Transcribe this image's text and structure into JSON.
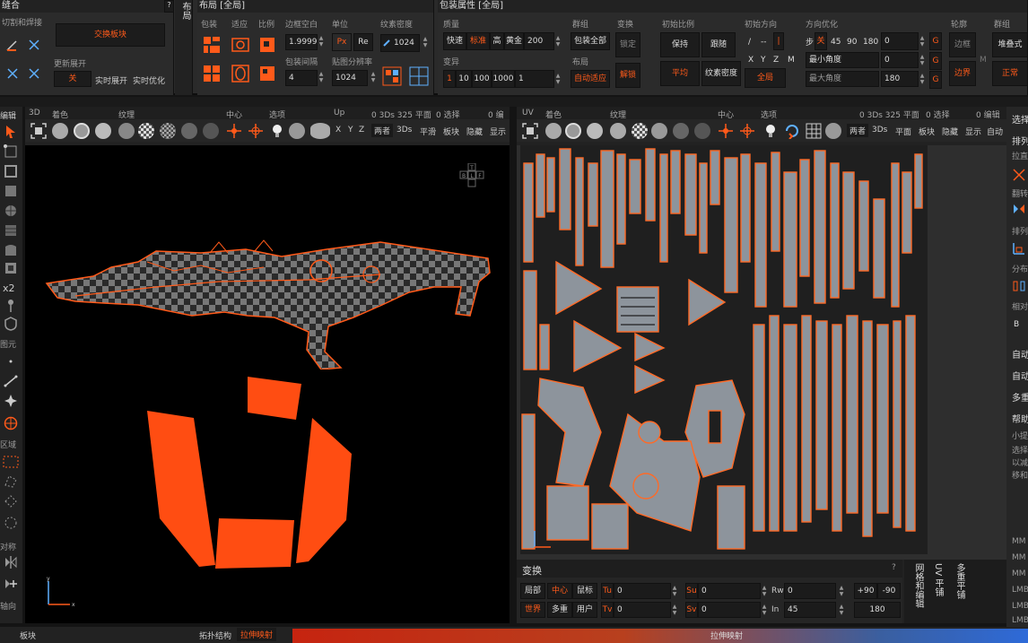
{
  "stitch_panel": {
    "title": "缝合",
    "cut_label": "切割和焊接",
    "swap_btn": "交换板块",
    "new_unfold": "更新展开",
    "off": "关",
    "realtime_unfold": "实时展开",
    "realtime_opt": "实时优化"
  },
  "side_tab": "布局",
  "layout_panel": {
    "title": "布局 [全局]",
    "pack": "包装",
    "adapt": "适应",
    "ratio": "比例",
    "margin": "边框空白",
    "unit": "单位",
    "texel": "纹素密度",
    "margin_val": "1.9999",
    "px": "Px",
    "re": "Re",
    "texel_val": "1024",
    "spacing": "包装间隔",
    "resolution": "贴图分辨率",
    "spacing_val": "4",
    "res_val": "1024"
  },
  "pack_props": {
    "title": "包装属性 [全局]",
    "quality": "质量",
    "fast": "快速",
    "standard": "标准",
    "high": "高",
    "gold": "黄金",
    "gold_val": "200",
    "group": "群组",
    "pack_all": "包装全部",
    "transform": "变换",
    "lock": "锁定",
    "init_ratio": "初始比例",
    "keep": "保持",
    "follow": "跟随",
    "init_dir": "初始方向",
    "slash": "/",
    "dashes": "-- ",
    "bar": "|",
    "dir_opt": "方向优化",
    "step": "步",
    "off": "关",
    "a45": "45",
    "a90": "90",
    "a180": "180",
    "a0": "0",
    "G": "G",
    "outline": "轮廓",
    "border": "边框",
    "group2": "群组",
    "stack": "堆叠式",
    "transform2": "变异",
    "v1": "1",
    "v10": "10",
    "v100": "100",
    "v1000": "1000",
    "v1b": "1",
    "layout": "布局",
    "auto_fit": "自动适应",
    "unlock": "解锁",
    "average": "平均",
    "texel2": "纹素密度",
    "X": "X",
    "Y": "Y",
    "Z": "Z",
    "M": "M",
    "min_angle": "最小角度",
    "min_val": "0",
    "global": "全局",
    "max_angle": "最大角度",
    "max_val": "180",
    "M2": "M",
    "boundary": "边界",
    "normal": "正常"
  },
  "view3d": {
    "bar": [
      "3D",
      "着色",
      "纹理",
      "中心",
      "选项",
      "Up",
      "0 3Ds 325 平面",
      "0 选择",
      "0 编辑"
    ],
    "tools": [
      "X",
      "Y",
      "Z",
      "两者",
      "3Ds",
      "平滑",
      "板块",
      "隐藏",
      "显示"
    ],
    "cube": [
      "T",
      "B",
      "L",
      "F",
      "R",
      "B"
    ]
  },
  "viewuv": {
    "bar": [
      "UV",
      "着色",
      "纹理",
      "中心",
      "选项",
      "0 3Ds 325 平面",
      "0 选择",
      "0 编辑"
    ],
    "tools": [
      "两者",
      "3Ds",
      "平面",
      "板块",
      "隐藏",
      "显示",
      "自动"
    ]
  },
  "left_tools": {
    "edit": "编辑",
    "x2": "x2",
    "prims": "图元",
    "region": "区域",
    "sym": "对称",
    "axis": "轴向"
  },
  "right_panel": {
    "select": "选择",
    "arrange": "排列",
    "pull": "拉直",
    "flip": "翻转",
    "sort": "排列",
    "dist": "分布",
    "rel": "相对",
    "b": "B",
    "auto1": "自动",
    "auto2": "自动",
    "multi": "多重",
    "help": "帮助",
    "tip": "小提",
    "sel": "选择",
    "desc1": "以减",
    "desc2": "移和",
    "mm": [
      "MM",
      "MM",
      "MM",
      "LMB",
      "LMB",
      "LMB"
    ]
  },
  "transform": {
    "title": "变换",
    "q": "?",
    "local": "局部",
    "center": "中心",
    "mouse": "鼠标",
    "world": "世界",
    "multi": "多重",
    "user": "用户",
    "Tu": "Tu",
    "Tv": "Tv",
    "Su": "Su",
    "Sv": "Sv",
    "Rw": "Rw",
    "In": "In",
    "tu_val": "0",
    "tv_val": "0",
    "su_val": "0",
    "sv_val": "0",
    "rw_val": "0",
    "in_val": "45",
    "p90": "+90",
    "m90": "-90",
    "v180": "180"
  },
  "vertical_tabs": [
    "网格和编辑",
    "UV 平铺",
    "多重平铺"
  ],
  "bottom": {
    "block": "板块",
    "topo": "拓扑结构",
    "stretch": "拉伸映射",
    "stretch2": "拉伸映射"
  },
  "colors": {
    "accent": "#ff5a1a",
    "bg": "#2b2b2b"
  }
}
